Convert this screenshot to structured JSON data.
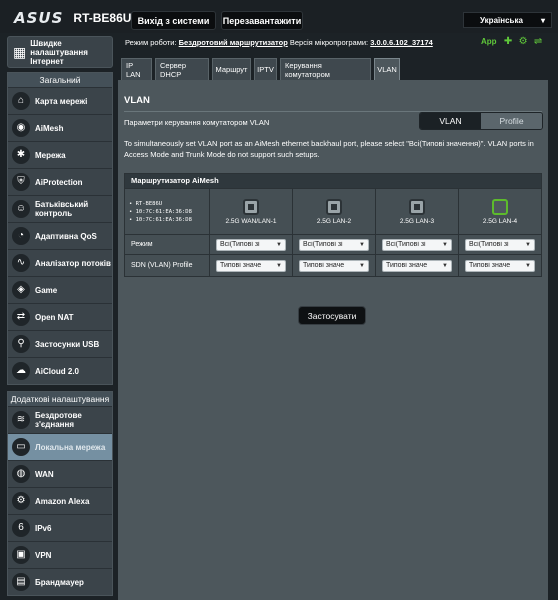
{
  "header": {
    "brand": "ASUS",
    "model": "RT-BE86U",
    "logout_label": "Вихід з системи",
    "reboot_label": "Перезавантажити",
    "language": "Українська"
  },
  "status": {
    "mode_label": "Режим роботи:",
    "mode_value": "Бездротовий маршрутизатор",
    "fw_label": "Версія мікропрограми:",
    "fw_value": "3.0.0.6.102_37174",
    "app_label": "App"
  },
  "sidebar": {
    "quick_setup": "Швидке налаштування Інтернет",
    "general_header": "Загальний",
    "general_items": [
      {
        "label": "Карта мережі",
        "icon": "network-map-icon"
      },
      {
        "label": "AiMesh",
        "icon": "aimesh-icon"
      },
      {
        "label": "Мережа",
        "icon": "network-icon"
      },
      {
        "label": "AiProtection",
        "icon": "aiprotection-icon"
      },
      {
        "label": "Батьківський контроль",
        "icon": "parental-control-icon"
      },
      {
        "label": "Адаптивна QoS",
        "icon": "qos-icon"
      },
      {
        "label": "Аналізатор потоків",
        "icon": "traffic-analyzer-icon"
      },
      {
        "label": "Game",
        "icon": "game-icon"
      },
      {
        "label": "Open NAT",
        "icon": "open-nat-icon"
      },
      {
        "label": "Застосунки USB",
        "icon": "usb-icon"
      },
      {
        "label": "AiCloud 2.0",
        "icon": "aicloud-icon"
      }
    ],
    "advanced_header": "Додаткові налаштування",
    "advanced_items": [
      {
        "label": "Бездротове з'єднання",
        "icon": "wireless-icon"
      },
      {
        "label": "Локальна мережа",
        "icon": "lan-icon"
      },
      {
        "label": "WAN",
        "icon": "wan-icon"
      },
      {
        "label": "Amazon Alexa",
        "icon": "alexa-icon"
      },
      {
        "label": "IPv6",
        "icon": "ipv6-icon"
      },
      {
        "label": "VPN",
        "icon": "vpn-icon"
      },
      {
        "label": "Брандмауер",
        "icon": "firewall-icon"
      }
    ],
    "active_item": "Локальна мережа"
  },
  "tabs": [
    "IP LAN",
    "Сервер DHCP",
    "Маршрут",
    "IPTV",
    "Керування комутатором",
    "VLAN"
  ],
  "active_tab": "VLAN",
  "main": {
    "title": "VLAN",
    "control_label": "Параметри керування комутатором VLAN",
    "segment": {
      "vlan": "VLAN",
      "profile": "Profile"
    },
    "note": "To simultaneously set VLAN port as an AiMesh ethernet backhaul port, please select \"Всі(Типові значення)\". VLAN ports in Access Mode and Trunk Mode do not support such setups.",
    "mesh_header": "Маршрутизатор AiMesh",
    "device": [
      "RT-BE86U",
      "10:7C:61:EA:36:D8",
      "10:7C:61:EA:36:D8"
    ],
    "ports": [
      "2.5G WAN/LAN-1",
      "2.5G LAN-2",
      "2.5G LAN-3",
      "2.5G LAN-4"
    ],
    "mode_label": "Режим",
    "profile_label": "SDN (VLAN) Profile",
    "mode_value": "Всі(Типові зі",
    "profile_value": "Типові значе",
    "apply_label": "Застосувати"
  }
}
